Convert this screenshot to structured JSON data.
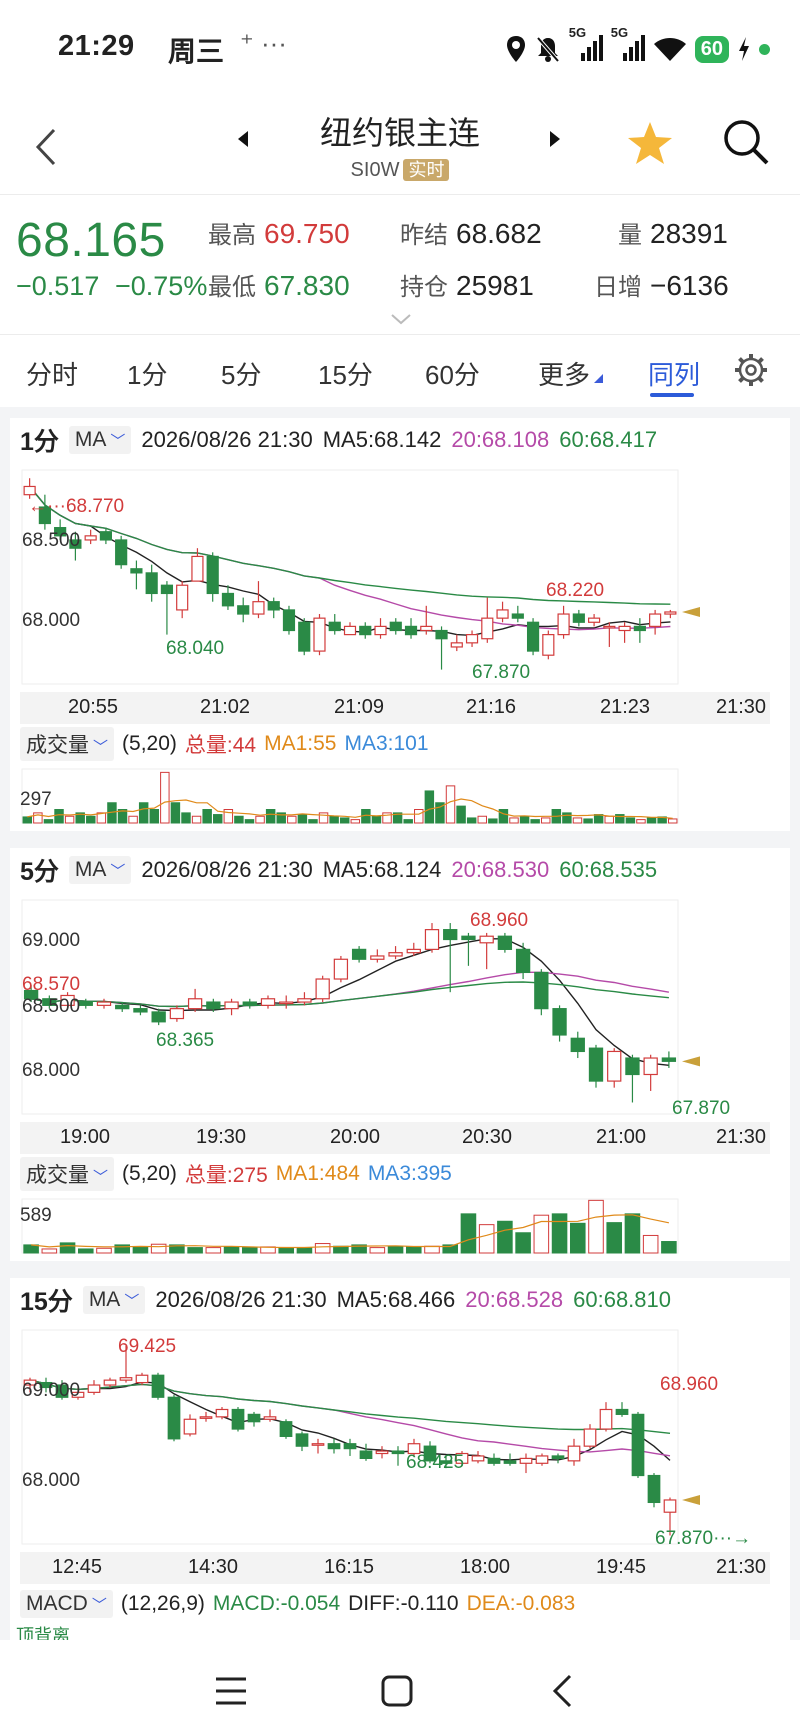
{
  "status_bar": {
    "time": "21:29",
    "day": "周三",
    "extra": "⁺ ···",
    "net1": "5G",
    "net2": "5G",
    "battery": "60"
  },
  "header": {
    "title": "纽约银主连",
    "code": "SI0W",
    "badge": "实时",
    "star_icon": "star-icon",
    "search_icon": "search-icon"
  },
  "quote": {
    "price": "68.165",
    "change": "−0.517",
    "change_pct": "−0.75%",
    "high_label": "最高",
    "high": "69.750",
    "low_label": "最低",
    "low": "67.830",
    "prev_label": "昨结",
    "prev": "68.682",
    "oi_label": "持仓",
    "oi": "25981",
    "vol_label": "量",
    "vol": "28391",
    "day_inc_label": "日增",
    "day_inc": "−6136"
  },
  "tabs": [
    "分时",
    "1分",
    "5分",
    "15分",
    "60分",
    "更多",
    "同列"
  ],
  "active_tab": "同列",
  "colors": {
    "up": "#d23b3b",
    "down": "#2a8a46",
    "ma5": "#222222",
    "ma20": "#b54aa8",
    "ma60": "#2a8a46",
    "active": "#2c5bd9"
  },
  "panels": {
    "p1": {
      "period": "1分",
      "indicator": "MA",
      "datetime": "2026/08/26 21:30",
      "ma5": "MA5:68.142",
      "ma20": "20:68.108",
      "ma60": "60:68.417",
      "price_ticks": [
        "68.500",
        "68.000"
      ],
      "marks": {
        "high": "←···68.770",
        "low1": "68.040",
        "low2": "67.870",
        "peak": "68.220"
      },
      "time_ticks": [
        "20:55",
        "21:02",
        "21:09",
        "21:16",
        "21:23",
        "21:30"
      ],
      "vol_indicator": "成交量",
      "vol_params": "(5,20)",
      "vol_total": "总量:44",
      "vol_ma1": "MA1:55",
      "vol_ma3": "MA3:101",
      "vol_tick": "297"
    },
    "p5": {
      "period": "5分",
      "indicator": "MA",
      "datetime": "2026/08/26 21:30",
      "ma5": "MA5:68.124",
      "ma20": "20:68.530",
      "ma60": "60:68.535",
      "price_ticks": [
        "69.000",
        "68.500",
        "68.000"
      ],
      "marks": {
        "prev": "68.570",
        "low1": "68.365",
        "high": "68.960",
        "low2": "67.870"
      },
      "time_ticks": [
        "19:00",
        "19:30",
        "20:00",
        "20:30",
        "21:00",
        "21:30"
      ],
      "vol_indicator": "成交量",
      "vol_params": "(5,20)",
      "vol_total": "总量:275",
      "vol_ma1": "MA1:484",
      "vol_ma3": "MA3:395",
      "vol_tick": "589"
    },
    "p15": {
      "period": "15分",
      "indicator": "MA",
      "datetime": "2026/08/26 21:30",
      "ma5": "MA5:68.466",
      "ma20": "20:68.528",
      "ma60": "60:68.810",
      "price_ticks": [
        "69.000",
        "68.000"
      ],
      "marks": {
        "high": "69.425",
        "low1": "68.425",
        "peak": "68.960",
        "low2": "67.870···→"
      },
      "time_ticks": [
        "12:45",
        "14:30",
        "16:15",
        "18:00",
        "19:45",
        "21:30"
      ],
      "macd_label": "MACD",
      "macd_params": "(12,26,9)",
      "macd": "MACD:-0.054",
      "diff": "DIFF:-0.110",
      "dea": "DEA:-0.083",
      "divergence": "顶背离"
    }
  },
  "candles": {
    "p1": [
      [
        68.72,
        68.76,
        68.8,
        68.7
      ],
      [
        68.66,
        68.58,
        68.72,
        68.55
      ],
      [
        68.56,
        68.52,
        68.6,
        68.5
      ],
      [
        68.5,
        68.46,
        68.54,
        68.4
      ],
      [
        68.5,
        68.52,
        68.55,
        68.48
      ],
      [
        68.54,
        68.5,
        68.56,
        68.48
      ],
      [
        68.5,
        68.38,
        68.52,
        68.36
      ],
      [
        68.36,
        68.34,
        68.4,
        68.26
      ],
      [
        68.34,
        68.24,
        68.38,
        68.2
      ],
      [
        68.28,
        68.24,
        68.3,
        68.04
      ],
      [
        68.16,
        68.28,
        68.3,
        68.12
      ],
      [
        68.3,
        68.42,
        68.46,
        68.3
      ],
      [
        68.42,
        68.24,
        68.44,
        68.2
      ],
      [
        68.24,
        68.18,
        68.28,
        68.16
      ],
      [
        68.18,
        68.14,
        68.22,
        68.1
      ],
      [
        68.14,
        68.2,
        68.3,
        68.12
      ],
      [
        68.2,
        68.16,
        68.22,
        68.12
      ],
      [
        68.16,
        68.06,
        68.18,
        68.04
      ],
      [
        68.1,
        67.96,
        68.12,
        67.94
      ],
      [
        67.96,
        68.12,
        68.14,
        67.94
      ],
      [
        68.1,
        68.06,
        68.14,
        68.04
      ],
      [
        68.04,
        68.08,
        68.1,
        68.04
      ],
      [
        68.08,
        68.04,
        68.1,
        68.02
      ],
      [
        68.04,
        68.08,
        68.12,
        68.02
      ],
      [
        68.1,
        68.06,
        68.12,
        68.04
      ],
      [
        68.08,
        68.04,
        68.12,
        68.02
      ],
      [
        68.06,
        68.08,
        68.18,
        68.04
      ],
      [
        68.06,
        68.02,
        68.08,
        67.87
      ],
      [
        67.98,
        68.0,
        68.04,
        67.96
      ],
      [
        68.0,
        68.04,
        68.06,
        67.98
      ],
      [
        68.02,
        68.12,
        68.22,
        68.0
      ],
      [
        68.12,
        68.16,
        68.2,
        68.1
      ],
      [
        68.14,
        68.12,
        68.18,
        68.1
      ],
      [
        68.1,
        67.96,
        68.12,
        67.94
      ],
      [
        67.94,
        68.04,
        68.06,
        67.92
      ],
      [
        68.04,
        68.14,
        68.18,
        68.02
      ],
      [
        68.14,
        68.1,
        68.16,
        68.08
      ],
      [
        68.1,
        68.12,
        68.14,
        68.08
      ],
      [
        68.08,
        68.08,
        68.1,
        67.98
      ],
      [
        68.06,
        68.08,
        68.1,
        68.0
      ],
      [
        68.08,
        68.06,
        68.12,
        68.0
      ],
      [
        68.08,
        68.14,
        68.16,
        68.04
      ],
      [
        68.14,
        68.15,
        68.16,
        68.12
      ]
    ],
    "p5": [
      [
        68.55,
        68.5,
        68.58,
        68.48
      ],
      [
        68.5,
        68.46,
        68.52,
        68.44
      ],
      [
        68.46,
        68.52,
        68.54,
        68.44
      ],
      [
        68.48,
        68.46,
        68.5,
        68.44
      ],
      [
        68.46,
        68.48,
        68.5,
        68.44
      ],
      [
        68.46,
        68.44,
        68.48,
        68.42
      ],
      [
        68.44,
        68.42,
        68.46,
        68.4
      ],
      [
        68.42,
        68.36,
        68.44,
        68.34
      ],
      [
        68.38,
        68.44,
        68.46,
        68.36
      ],
      [
        68.44,
        68.5,
        68.56,
        68.42
      ],
      [
        68.48,
        68.44,
        68.5,
        68.42
      ],
      [
        68.44,
        68.48,
        68.5,
        68.4
      ],
      [
        68.48,
        68.46,
        68.5,
        68.44
      ],
      [
        68.46,
        68.5,
        68.52,
        68.44
      ],
      [
        68.48,
        68.48,
        68.52,
        68.44
      ],
      [
        68.48,
        68.5,
        68.54,
        68.46
      ],
      [
        68.5,
        68.62,
        68.64,
        68.48
      ],
      [
        68.62,
        68.74,
        68.76,
        68.6
      ],
      [
        68.8,
        68.74,
        68.82,
        68.72
      ],
      [
        68.74,
        68.76,
        68.8,
        68.72
      ],
      [
        68.76,
        68.78,
        68.82,
        68.74
      ],
      [
        68.78,
        68.8,
        68.84,
        68.76
      ],
      [
        68.8,
        68.92,
        68.96,
        68.78
      ],
      [
        68.92,
        68.86,
        68.96,
        68.54
      ],
      [
        68.88,
        68.86,
        68.9,
        68.7
      ],
      [
        68.84,
        68.88,
        68.9,
        68.68
      ],
      [
        68.88,
        68.8,
        68.9,
        68.78
      ],
      [
        68.8,
        68.66,
        68.84,
        68.62
      ],
      [
        68.66,
        68.44,
        68.68,
        68.4
      ],
      [
        68.44,
        68.28,
        68.46,
        68.24
      ],
      [
        68.26,
        68.18,
        68.3,
        68.14
      ],
      [
        68.2,
        68.0,
        68.22,
        67.96
      ],
      [
        68.0,
        68.18,
        68.2,
        67.96
      ],
      [
        68.14,
        68.04,
        68.16,
        67.87
      ],
      [
        68.04,
        68.14,
        68.16,
        67.94
      ],
      [
        68.14,
        68.12,
        68.18,
        68.08
      ]
    ],
    "p15": [
      [
        69.1,
        69.14,
        69.16,
        69.04
      ],
      [
        69.12,
        69.08,
        69.16,
        69.04
      ],
      [
        69.1,
        69.0,
        69.14,
        68.98
      ],
      [
        69.0,
        69.04,
        69.08,
        68.98
      ],
      [
        69.04,
        69.1,
        69.14,
        69.02
      ],
      [
        69.1,
        69.14,
        69.16,
        69.08
      ],
      [
        69.14,
        69.16,
        69.42,
        69.12
      ],
      [
        69.12,
        69.18,
        69.2,
        69.1
      ],
      [
        69.18,
        69.0,
        69.2,
        68.98
      ],
      [
        69.0,
        68.66,
        69.02,
        68.64
      ],
      [
        68.7,
        68.82,
        68.86,
        68.68
      ],
      [
        68.84,
        68.84,
        68.88,
        68.8
      ],
      [
        68.84,
        68.9,
        68.92,
        68.82
      ],
      [
        68.9,
        68.74,
        68.92,
        68.72
      ],
      [
        68.86,
        68.8,
        68.88,
        68.76
      ],
      [
        68.82,
        68.84,
        68.9,
        68.8
      ],
      [
        68.8,
        68.68,
        68.82,
        68.66
      ],
      [
        68.7,
        68.6,
        68.72,
        68.56
      ],
      [
        68.62,
        68.62,
        68.66,
        68.54
      ],
      [
        68.62,
        68.58,
        68.66,
        68.54
      ],
      [
        68.62,
        68.58,
        68.66,
        68.52
      ],
      [
        68.56,
        68.5,
        68.62,
        68.48
      ],
      [
        68.54,
        68.56,
        68.6,
        68.5
      ],
      [
        68.56,
        68.54,
        68.6,
        68.44
      ],
      [
        68.54,
        68.62,
        68.66,
        68.52
      ],
      [
        68.6,
        68.48,
        68.64,
        68.46
      ],
      [
        68.48,
        68.46,
        68.52,
        68.42
      ],
      [
        68.46,
        68.54,
        68.56,
        68.44
      ],
      [
        68.48,
        68.52,
        68.56,
        68.46
      ],
      [
        68.5,
        68.46,
        68.54,
        68.44
      ],
      [
        68.48,
        68.46,
        68.54,
        68.44
      ],
      [
        68.46,
        68.5,
        68.54,
        68.38
      ],
      [
        68.46,
        68.52,
        68.54,
        68.44
      ],
      [
        68.52,
        68.5,
        68.54,
        68.46
      ],
      [
        68.48,
        68.6,
        68.66,
        68.44
      ],
      [
        68.6,
        68.74,
        68.78,
        68.58
      ],
      [
        68.74,
        68.9,
        68.96,
        68.72
      ],
      [
        68.9,
        68.86,
        68.96,
        68.84
      ],
      [
        68.86,
        68.36,
        68.88,
        68.34
      ],
      [
        68.36,
        68.14,
        68.38,
        68.1
      ],
      [
        68.06,
        68.16,
        68.18,
        67.87
      ]
    ]
  },
  "volumes": {
    "p1": [
      18,
      30,
      10,
      40,
      20,
      30,
      20,
      30,
      60,
      40,
      20,
      60,
      40,
      150,
      60,
      30,
      20,
      40,
      25,
      40,
      20,
      10,
      20,
      40,
      30,
      20,
      25,
      10,
      30,
      20,
      15,
      10,
      40,
      20,
      30,
      30,
      10,
      40,
      95,
      60,
      110,
      50,
      15,
      20,
      12,
      40,
      15,
      20,
      10,
      15,
      40,
      30,
      15,
      12,
      25,
      20,
      25,
      15,
      10,
      15,
      18,
      12
    ],
    "p5": [
      120,
      60,
      150,
      60,
      70,
      120,
      90,
      130,
      120,
      80,
      80,
      90,
      80,
      90,
      70,
      80,
      140,
      100,
      120,
      80,
      90,
      90,
      100,
      120,
      580,
      420,
      470,
      300,
      560,
      580,
      440,
      780,
      450,
      580,
      260,
      170
    ],
    "p15": []
  },
  "nav": {
    "menu_icon": "menu-icon",
    "home_icon": "home-icon",
    "back_icon": "back-icon"
  }
}
